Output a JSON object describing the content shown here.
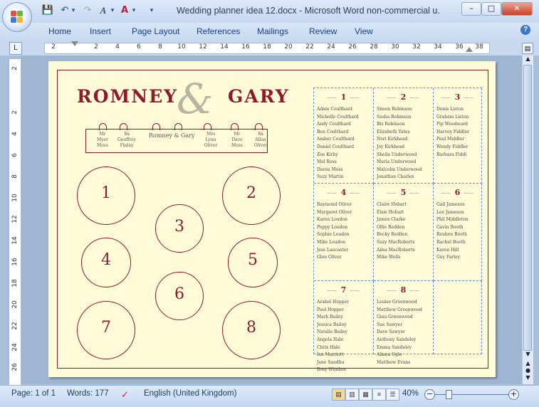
{
  "window": {
    "title": "Wedding planner idea 12.docx - Microsoft Word non-commercial u...",
    "controls": {
      "minimize": "–",
      "maximize": "□",
      "close": "✕"
    }
  },
  "qat": [
    "save-icon",
    "undo-icon",
    "redo-icon",
    "text-effect-icon",
    "font-color-icon",
    "customize-icon"
  ],
  "tabs": [
    "Home",
    "Insert",
    "Page Layout",
    "References",
    "Mailings",
    "Review",
    "View"
  ],
  "ruler_numbers": [
    "2",
    "2",
    "4",
    "6",
    "8",
    "10",
    "12",
    "14",
    "16",
    "18",
    "20",
    "22",
    "24",
    "26",
    "28",
    "30",
    "32",
    "34",
    "36",
    "38"
  ],
  "vruler_numbers": [
    "2",
    "2",
    "4",
    "6",
    "8",
    "10",
    "12",
    "14",
    "16",
    "18",
    "20",
    "22",
    "24",
    "26"
  ],
  "document": {
    "bride": "ROMNEY",
    "groom": "GARY",
    "ampersand": "&",
    "head_table": {
      "center": "Romney & Gary",
      "left_seats": [
        {
          "line1": "Mr",
          "line2": "Myer",
          "line3": "Moss"
        },
        {
          "line1": "Ss",
          "line2": "Geoffrey",
          "line3": "Finlay"
        }
      ],
      "right_seats": [
        {
          "line1": "Mrs",
          "line2": "Lynn",
          "line3": "Oliver"
        },
        {
          "line1": "Mr",
          "line2": "Dave",
          "line3": "Moss"
        },
        {
          "line1": "Ss",
          "line2": "Allan",
          "line3": "Oliver"
        }
      ]
    },
    "table_numbers": [
      "1",
      "2",
      "3",
      "4",
      "5",
      "6",
      "7",
      "8"
    ],
    "guest_tables": [
      {
        "num": "1",
        "guests": [
          "Adam Coulthard",
          "Michelle Coulthard",
          "Andy Coulthard",
          "Ben Coulthard",
          "Amber Coulthard",
          "Daniel Coulthard",
          "Zoe Kirby",
          "Mel Ross",
          "Daren Moss",
          "Suzy Martin"
        ]
      },
      {
        "num": "2",
        "guests": [
          "Simon Robinson",
          "Sasha Robinson",
          "Biz Robinson",
          "Elizabeth Yates",
          "Nori Kirkhead",
          "Joy Kirkhead",
          "Sheila Underwood",
          "Maria Underwood",
          "Malcolm Underwood",
          "Jonathan Charles"
        ]
      },
      {
        "num": "3",
        "guests": [
          "Denis Liston",
          "Graham Liston",
          "Pip Woodward",
          "Harvey Fiddler",
          "Paul Middler",
          "Wendy Fiddler",
          "Barbara Fiddi"
        ]
      },
      {
        "num": "4",
        "guests": [
          "Raymond Oliver",
          "Margaret Oliver",
          "Karen Loudon",
          "Poppy Loudon",
          "Sophie Loudon",
          "Mike Loudon",
          "Jess Lancaster",
          "Glen Oliver"
        ]
      },
      {
        "num": "5",
        "guests": [
          "Claire Hobart",
          "Elsie Hobart",
          "James Clarke",
          "Ollie Redden",
          "Becky Redden",
          "Suzy MacRoberts",
          "Ailsa MacRoberts",
          "Mike Wells"
        ]
      },
      {
        "num": "6",
        "guests": [
          "Gail Jameson",
          "Lee Jameson",
          "Phil Middleton",
          "Gavin Booth",
          "Reuben Booth",
          "Rachel Booth",
          "Karen Hill",
          "Guy Farley"
        ]
      },
      {
        "num": "7",
        "guests": [
          "Arabel Hopper",
          "Paul Hopper",
          "Mark Bailey",
          "Jessica Bailey",
          "Natalie Bailey",
          "Angela Hale",
          "Chris Hale",
          "Ian Marriott",
          "Jane Sandhu",
          "Rosy Windsor"
        ]
      },
      {
        "num": "8",
        "guests": [
          "Louise Greenwood",
          "Matthew Greenwood",
          "Gina Greenwood",
          "Sue Sawyer",
          "Dave Sawyer",
          "Anthony Sandeley",
          "Emma Sandeley",
          "Aliana Ogle",
          "Matthew Evans"
        ]
      },
      {
        "num": "",
        "guests": []
      }
    ]
  },
  "status": {
    "page": "Page: 1 of 1",
    "words": "Words: 177",
    "language": "English (United Kingdom)",
    "zoom": "40%",
    "zoom_minus": "−",
    "zoom_plus": "+"
  },
  "colors": {
    "accent": "#8b1c2b",
    "page": "#fffbd9",
    "grid": "#6a8cd0"
  }
}
